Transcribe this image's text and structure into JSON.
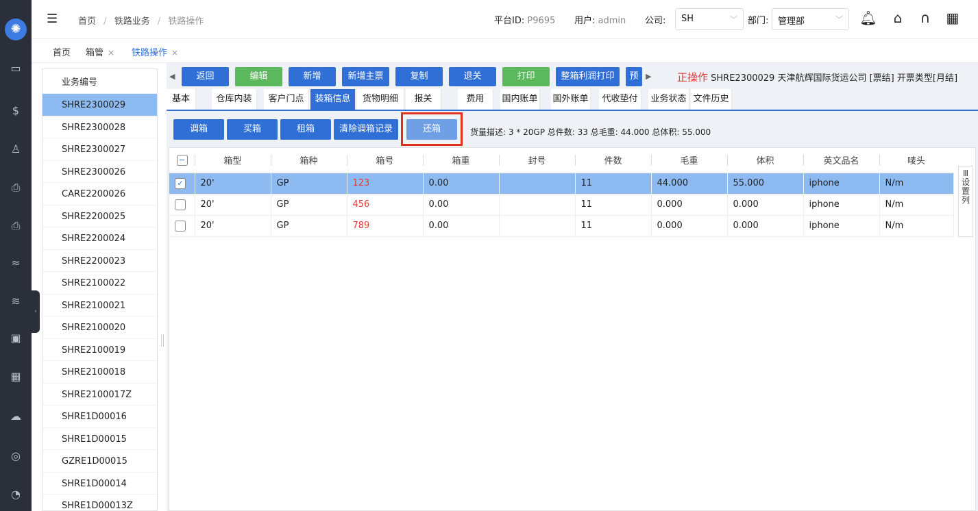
{
  "header": {
    "breadcrumb": [
      "首页",
      "铁路业务",
      "铁路操作"
    ],
    "platform_label": "平台ID:",
    "platform_id": "P9695",
    "user_label": "用户:",
    "user": "admin",
    "company_label": "公司:",
    "company": "SH",
    "dept_label": "部门:",
    "dept": "管理部"
  },
  "tabs": [
    "首页",
    "箱管",
    "铁路操作"
  ],
  "list": {
    "header": "业务编号",
    "items": [
      "SHRE2300029",
      "SHRE2300028",
      "SHRE2300027",
      "SHRE2300026",
      "CARE2200026",
      "SHRE2200025",
      "SHRE2200024",
      "SHRE2200023",
      "SHRE2100022",
      "SHRE2100021",
      "SHRE2100020",
      "SHRE2100019",
      "SHRE2100018",
      "SHRE2100017Z",
      "SHRE1D00016",
      "SHRE1D00015",
      "GZRE1D00015",
      "SHRE1D00014",
      "SHRE1D00013Z"
    ],
    "selected": 0
  },
  "actions": [
    "返回",
    "编辑",
    "新增",
    "新增主票",
    "复制",
    "退关",
    "打印",
    "整箱利润打印",
    "预"
  ],
  "status": {
    "label": "正操作",
    "text": "SHRE2300029  天津航辉国际货运公司 [票结]  开票类型[月结]"
  },
  "subtabs": [
    "基本",
    "仓库内装",
    "客户门点",
    "装箱信息",
    "货物明细",
    "报关",
    "费用",
    "国内账单",
    "国外账单",
    "代收垫付",
    "业务状态",
    "文件历史"
  ],
  "active_subtab": 3,
  "ops": [
    "调箱",
    "买箱",
    "租箱",
    "清除调箱记录",
    "还箱"
  ],
  "cargo_desc": "货量描述: 3 * 20GP 总件数: 33 总毛重: 44.000 总体积: 55.000",
  "table": {
    "columns": [
      "箱型",
      "箱种",
      "箱号",
      "箱重",
      "封号",
      "件数",
      "毛重",
      "体积",
      "英文品名",
      "唛头"
    ],
    "rows": [
      [
        "20'",
        "GP",
        "123",
        "0.00",
        "",
        "11",
        "44.000",
        "55.000",
        "iphone",
        "N/m"
      ],
      [
        "20'",
        "GP",
        "456",
        "0.00",
        "",
        "11",
        "0.000",
        "0.000",
        "iphone",
        "N/m"
      ],
      [
        "20'",
        "GP",
        "789",
        "0.00",
        "",
        "11",
        "0.000",
        "0.000",
        "iphone",
        "N/m"
      ]
    ],
    "checked_row": 0,
    "column_settings": "设置列"
  },
  "icons": {
    "logo": "compass-logo-icon",
    "sidebar": [
      "folder-icon",
      "dollar-doc-icon",
      "users-icon",
      "printer-icon",
      "printer-2-icon",
      "fish-icon",
      "cars-icon",
      "train-icon",
      "grid-icon",
      "cloud-upload-icon",
      "coin-icon",
      "pie-icon"
    ],
    "header": [
      "bell-icon",
      "home-icon",
      "headset-icon",
      "apps-icon"
    ]
  }
}
